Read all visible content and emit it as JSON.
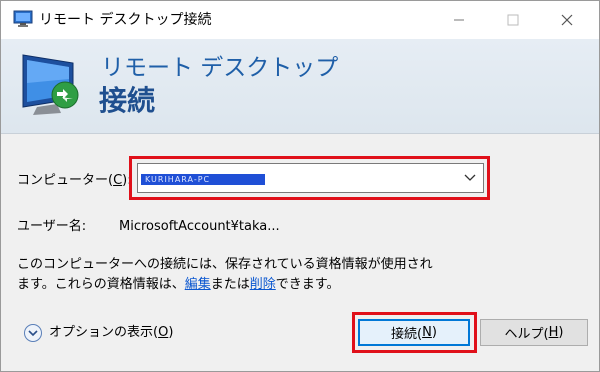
{
  "window": {
    "title": "リモート デスクトップ接続",
    "icon": "remote-desktop-icon"
  },
  "banner": {
    "line1": "リモート デスクトップ",
    "line2": "接続",
    "icon": "monitor-remote-icon"
  },
  "form": {
    "computer_label_prefix": "コンピューター(",
    "computer_label_key": "C",
    "computer_label_suffix": "):",
    "computer_value": "KURIHARA-PC",
    "username_label": "ユーザー名:",
    "username_value": "MicrosoftAccount¥taka..."
  },
  "info": {
    "part1": "このコンピューターへの接続には、保存されている資格情報が使用されます。これらの資格情報は、",
    "edit_link": "編集",
    "part2": "または",
    "delete_link": "削除",
    "part3": "できます。"
  },
  "footer": {
    "options_prefix": "オプションの表示(",
    "options_key": "O",
    "options_suffix": ")",
    "connect_prefix": "接続(",
    "connect_key": "N",
    "connect_suffix": ")",
    "help_prefix": "ヘルプ(",
    "help_key": "H",
    "help_suffix": ")"
  },
  "colors": {
    "highlight": "#e0101a",
    "banner_text": "#1f5fa8",
    "link": "#0b57d0",
    "selection": "#1f4fd6"
  }
}
